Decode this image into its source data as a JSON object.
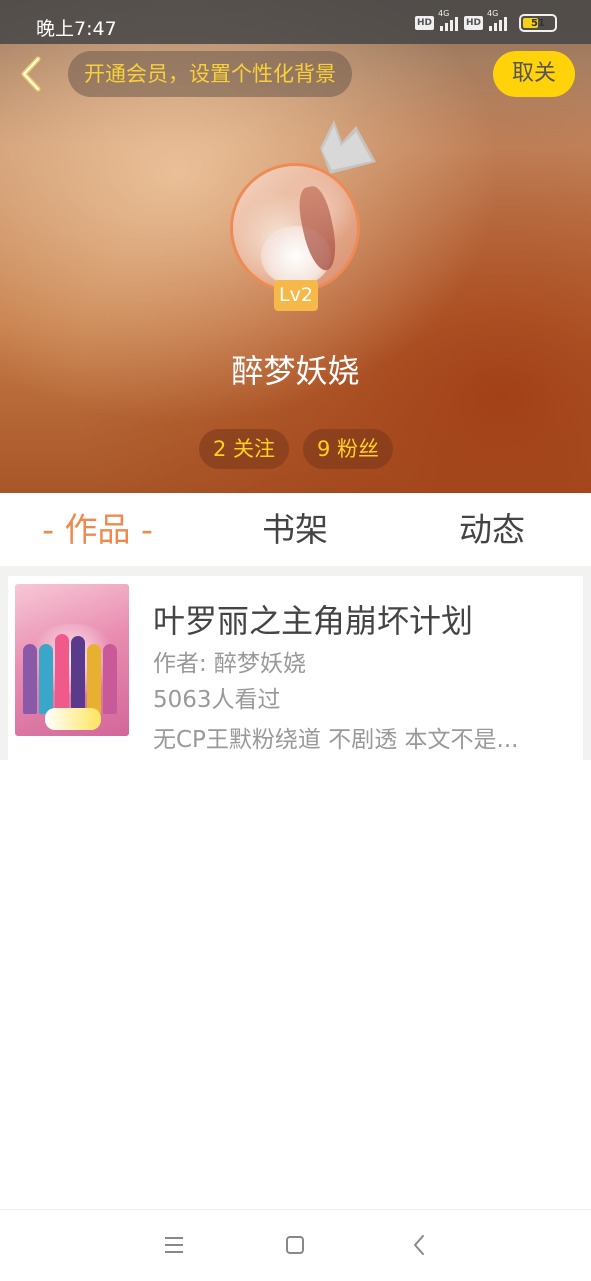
{
  "status_bar": {
    "time": "晚上7:47",
    "network_1": "4G",
    "network_2": "4G",
    "hd_label": "HD",
    "battery": "51"
  },
  "header": {
    "vip_prompt": "开通会员，设置个性化背景",
    "unfollow_label": "取关"
  },
  "profile": {
    "level": "Lv2",
    "username": "醉梦妖娆",
    "following": "2 关注",
    "fans": "9 粉丝"
  },
  "tabs": [
    {
      "label": "- 作品 -",
      "active": true
    },
    {
      "label": "书架",
      "active": false
    },
    {
      "label": "动态",
      "active": false
    }
  ],
  "works": [
    {
      "title": "叶罗丽之主角崩坏计划",
      "author": "作者: 醉梦妖娆",
      "views": "5063人看过",
      "description": "无CP王默粉绕道 不剧透  本文不是..."
    }
  ],
  "colors": {
    "accent": "#ef8a4e",
    "unfollow_bg": "#ffd20a",
    "level_bg": "#f7b84a",
    "stat_text": "#ffd020"
  },
  "icons": {
    "back": "chevron-left-icon",
    "crown": "crown-icon",
    "nav_menu": "menu-icon",
    "nav_home": "square-home-icon",
    "nav_back": "chevron-left-icon"
  }
}
